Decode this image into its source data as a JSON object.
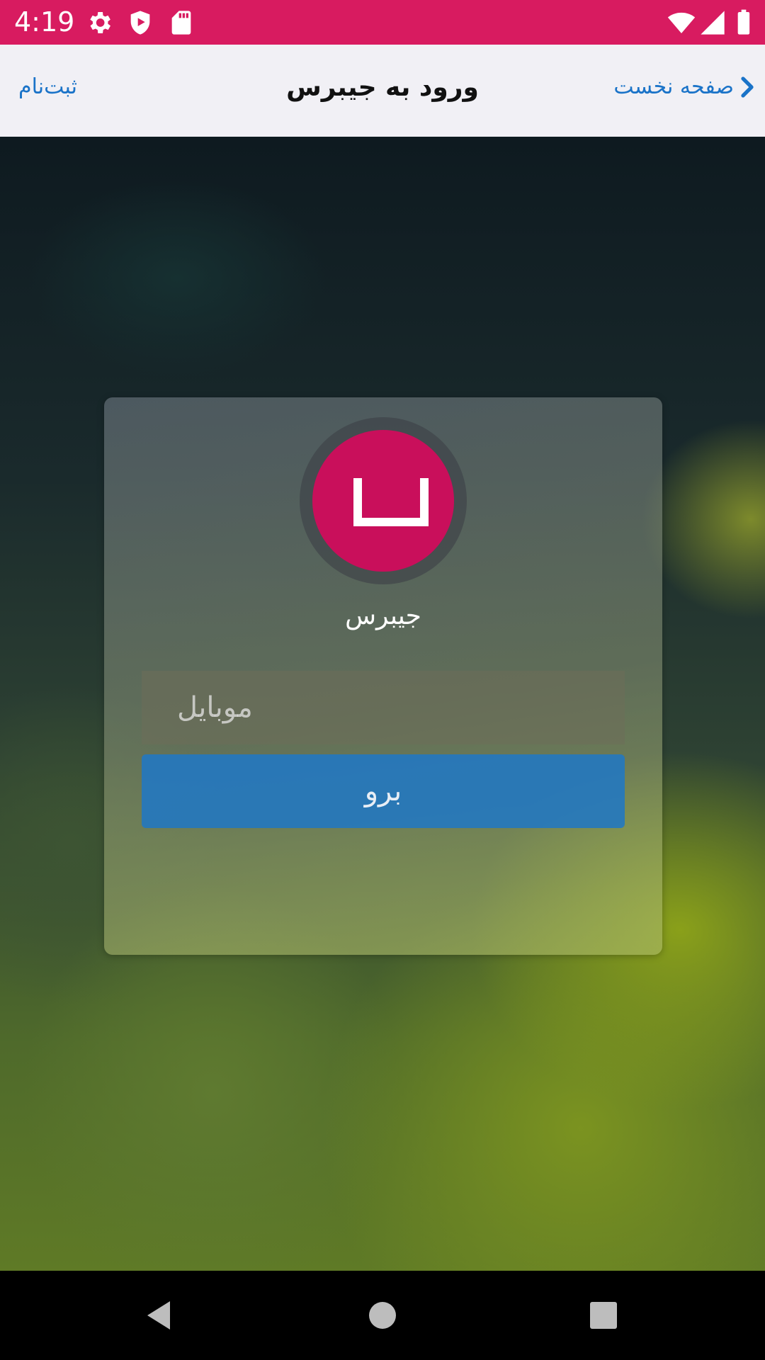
{
  "status_bar": {
    "time": "4:19",
    "icons": [
      "settings-icon",
      "play-protect-icon",
      "sd-card-icon",
      "wifi-icon",
      "signal-icon",
      "battery-icon"
    ],
    "color": "#d81b60"
  },
  "app_bar": {
    "title": "ورود به جیبرس",
    "back_label": "صفحه نخست",
    "register_label": "ثبت‌نام",
    "link_color": "#1a73c8"
  },
  "login_card": {
    "brand_name": "جیبرس",
    "logo_color": "#c90f5b",
    "mobile_placeholder": "موبایل",
    "mobile_value": "",
    "submit_label": "برو",
    "submit_color": "#2178c3"
  },
  "nav_bar": {
    "buttons": [
      "back-triangle-icon",
      "home-circle-icon",
      "recents-square-icon"
    ]
  }
}
